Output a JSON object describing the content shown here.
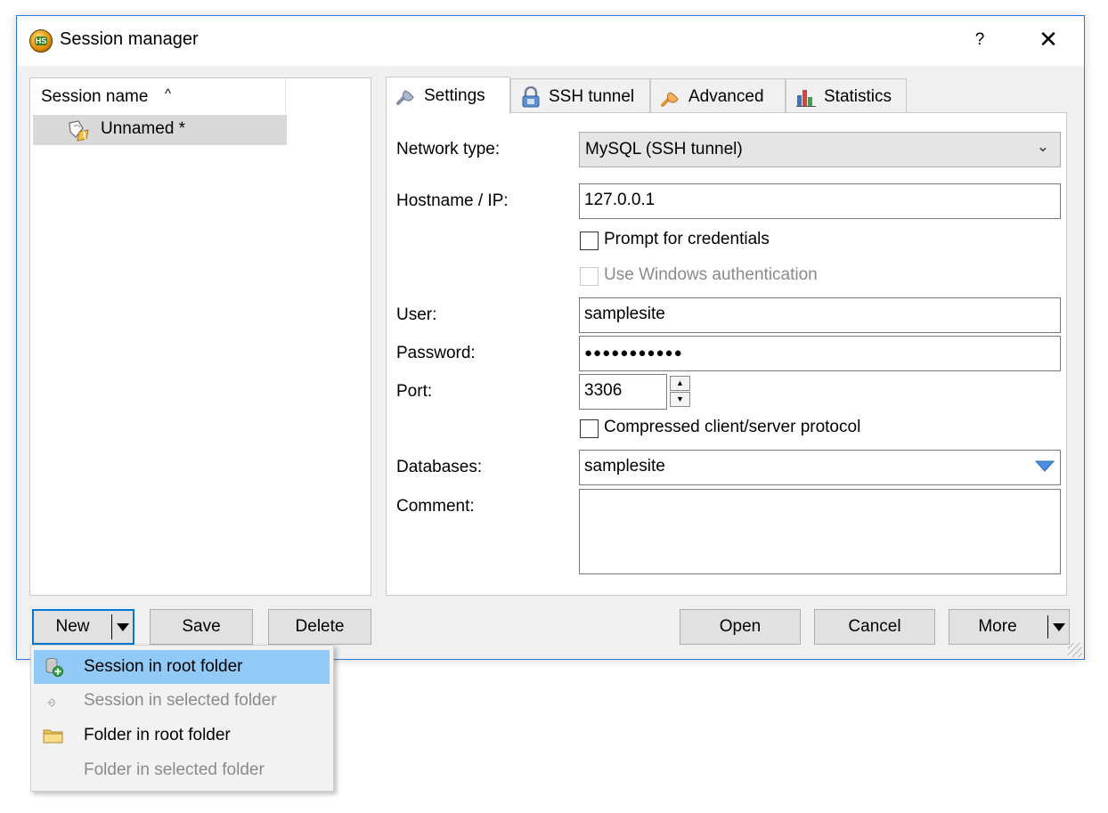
{
  "window": {
    "title": "Session manager",
    "help_label": "?",
    "close_label": "✕"
  },
  "session_list": {
    "column_header": "Session name",
    "sort_indicator": "^",
    "items": [
      {
        "label": "Unnamed *",
        "icon": "session-icon",
        "selected": true
      }
    ]
  },
  "tabs": [
    {
      "label": "Settings",
      "icon": "wrench-icon",
      "active": true
    },
    {
      "label": "SSH tunnel",
      "icon": "lock-icon",
      "active": false
    },
    {
      "label": "Advanced",
      "icon": "wrench-icon",
      "active": false
    },
    {
      "label": "Statistics",
      "icon": "bar-chart-icon",
      "active": false
    }
  ],
  "settings": {
    "network_type": {
      "label": "Network type:",
      "value": "MySQL (SSH tunnel)"
    },
    "hostname": {
      "label": "Hostname / IP:",
      "value": "127.0.0.1"
    },
    "prompt_credentials": {
      "label": "Prompt for credentials",
      "checked": false
    },
    "windows_auth": {
      "label": "Use Windows authentication",
      "checked": false,
      "enabled": false
    },
    "user": {
      "label": "User:",
      "value": "samplesite"
    },
    "password": {
      "label": "Password:",
      "value": "●●●●●●●●●●●"
    },
    "port": {
      "label": "Port:",
      "value": "3306"
    },
    "compressed": {
      "label": "Compressed client/server protocol",
      "checked": false
    },
    "databases": {
      "label": "Databases:",
      "value": "samplesite"
    },
    "comment": {
      "label": "Comment:",
      "value": ""
    }
  },
  "buttons": {
    "new": "New",
    "save": "Save",
    "delete": "Delete",
    "open": "Open",
    "cancel": "Cancel",
    "more": "More"
  },
  "new_menu": {
    "items": [
      {
        "label": "Session in root folder",
        "icon": "new-session-icon",
        "enabled": true,
        "highlighted": true
      },
      {
        "label": "Session in selected folder",
        "icon": "new-session-folder-icon",
        "enabled": false,
        "highlighted": false
      },
      {
        "label": "Folder in root folder",
        "icon": "folder-icon",
        "enabled": true,
        "highlighted": false
      },
      {
        "label": "Folder in selected folder",
        "icon": "",
        "enabled": false,
        "highlighted": false
      }
    ]
  },
  "colors": {
    "accent": "#0078d7",
    "menu_highlight": "#91c9f7",
    "selection": "#d9d9d9",
    "window_border": "#2b7bd4"
  }
}
